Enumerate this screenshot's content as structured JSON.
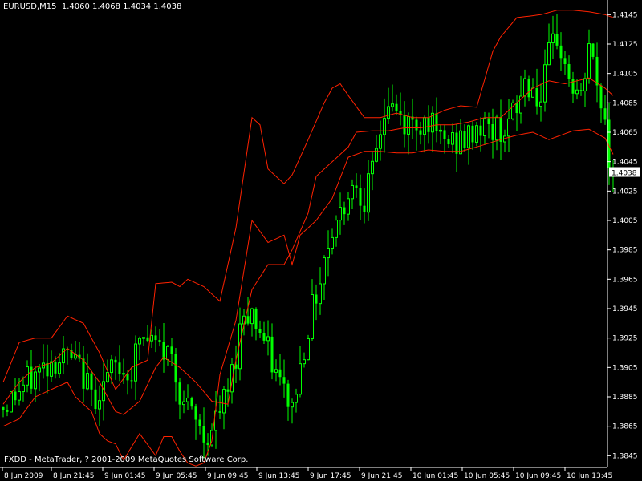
{
  "header": {
    "symbol": "EURUSD,M15",
    "ohlc": "1.4060 1.4068 1.4034 1.4038"
  },
  "footer": {
    "copyright": "FXDD - MetaTrader, ? 2001-2009 MetaQuotes Software Corp."
  },
  "colors": {
    "background": "#000000",
    "candle": "#00ff00",
    "bands": "#ff2200",
    "axis": "#ffffff",
    "price_line": "#c0c0c0"
  },
  "chart_data": {
    "type": "candlestick",
    "ylim": [
      1.3837,
      1.4155
    ],
    "y_ticks": [
      "1.4145",
      "1.4125",
      "1.4105",
      "1.4085",
      "1.4065",
      "1.4045",
      "1.4025",
      "1.4005",
      "1.3985",
      "1.3965",
      "1.3945",
      "1.3925",
      "1.3905",
      "1.3885",
      "1.3865",
      "1.3845"
    ],
    "x_ticks": [
      "8 Jun 2009",
      "8 Jun 21:45",
      "9 Jun 01:45",
      "9 Jun 05:45",
      "9 Jun 09:45",
      "9 Jun 13:45",
      "9 Jun 17:45",
      "9 Jun 21:45",
      "10 Jun 01:45",
      "10 Jun 05:45",
      "10 Jun 09:45",
      "10 Jun 13:45"
    ],
    "current_price": "1.4038",
    "close_path": [
      [
        0,
        1.3878
      ],
      [
        6,
        1.3895
      ],
      [
        12,
        1.391
      ],
      [
        16,
        1.3912
      ],
      [
        20,
        1.39
      ],
      [
        22,
        1.3885
      ],
      [
        24,
        1.389
      ],
      [
        28,
        1.3905
      ],
      [
        32,
        1.3902
      ],
      [
        34,
        1.3925
      ],
      [
        38,
        1.392
      ],
      [
        42,
        1.3912
      ],
      [
        44,
        1.389
      ],
      [
        46,
        1.3875
      ],
      [
        48,
        1.3868
      ],
      [
        50,
        1.3858
      ],
      [
        52,
        1.3862
      ],
      [
        56,
        1.3888
      ],
      [
        58,
        1.3915
      ],
      [
        60,
        1.3945
      ],
      [
        62,
        1.3942
      ],
      [
        64,
        1.393
      ],
      [
        66,
        1.3915
      ],
      [
        68,
        1.39
      ],
      [
        70,
        1.3888
      ],
      [
        72,
        1.3878
      ],
      [
        74,
        1.3905
      ],
      [
        76,
        1.3935
      ],
      [
        78,
        1.3955
      ],
      [
        80,
        1.398
      ],
      [
        82,
        1.4
      ],
      [
        84,
        1.401
      ],
      [
        86,
        1.4025
      ],
      [
        88,
        1.4032
      ],
      [
        90,
        1.402
      ],
      [
        92,
        1.4035
      ],
      [
        94,
        1.4068
      ],
      [
        96,
        1.4085
      ],
      [
        100,
        1.407
      ],
      [
        104,
        1.4072
      ],
      [
        106,
        1.4075
      ],
      [
        108,
        1.406
      ],
      [
        112,
        1.4058
      ],
      [
        116,
        1.406
      ],
      [
        118,
        1.407
      ],
      [
        122,
        1.4066
      ],
      [
        126,
        1.407
      ],
      [
        128,
        1.408
      ],
      [
        130,
        1.41
      ],
      [
        132,
        1.4095
      ],
      [
        134,
        1.4085
      ],
      [
        136,
        1.4115
      ],
      [
        138,
        1.413
      ],
      [
        140,
        1.411
      ],
      [
        142,
        1.4095
      ],
      [
        144,
        1.4085
      ],
      [
        146,
        1.4125
      ],
      [
        148,
        1.4095
      ],
      [
        150,
        1.4075
      ],
      [
        151,
        1.4045
      ],
      [
        152,
        1.4038
      ]
    ],
    "band_upper": [
      [
        0,
        1.3895
      ],
      [
        4,
        1.3922
      ],
      [
        8,
        1.3925
      ],
      [
        12,
        1.3925
      ],
      [
        16,
        1.394
      ],
      [
        20,
        1.3935
      ],
      [
        24,
        1.3915
      ],
      [
        28,
        1.389
      ],
      [
        32,
        1.3905
      ],
      [
        36,
        1.391
      ],
      [
        38,
        1.3962
      ],
      [
        42,
        1.3963
      ],
      [
        44,
        1.396
      ],
      [
        46,
        1.3965
      ],
      [
        50,
        1.396
      ],
      [
        54,
        1.395
      ],
      [
        58,
        1.4
      ],
      [
        62,
        1.4075
      ],
      [
        64,
        1.407
      ],
      [
        66,
        1.404
      ],
      [
        70,
        1.403
      ],
      [
        72,
        1.4036
      ],
      [
        76,
        1.406
      ],
      [
        80,
        1.4085
      ],
      [
        82,
        1.4095
      ],
      [
        84,
        1.4098
      ],
      [
        86,
        1.409
      ],
      [
        90,
        1.4075
      ],
      [
        94,
        1.4075
      ],
      [
        98,
        1.4078
      ],
      [
        102,
        1.4075
      ],
      [
        106,
        1.4075
      ],
      [
        110,
        1.408
      ],
      [
        114,
        1.4083
      ],
      [
        118,
        1.4082
      ],
      [
        122,
        1.412
      ],
      [
        124,
        1.413
      ],
      [
        128,
        1.4143
      ],
      [
        134,
        1.4145
      ],
      [
        138,
        1.4148
      ],
      [
        142,
        1.4148
      ],
      [
        146,
        1.4147
      ],
      [
        150,
        1.4145
      ],
      [
        152,
        1.4143
      ]
    ],
    "band_middle": [
      [
        0,
        1.388
      ],
      [
        4,
        1.3895
      ],
      [
        8,
        1.3905
      ],
      [
        12,
        1.3908
      ],
      [
        16,
        1.3918
      ],
      [
        20,
        1.391
      ],
      [
        24,
        1.3895
      ],
      [
        28,
        1.3875
      ],
      [
        30,
        1.3873
      ],
      [
        34,
        1.3882
      ],
      [
        38,
        1.3905
      ],
      [
        40,
        1.3912
      ],
      [
        44,
        1.3905
      ],
      [
        48,
        1.3895
      ],
      [
        52,
        1.3882
      ],
      [
        56,
        1.388
      ],
      [
        58,
        1.391
      ],
      [
        62,
        1.3958
      ],
      [
        66,
        1.3975
      ],
      [
        70,
        1.3975
      ],
      [
        72,
        1.3985
      ],
      [
        76,
        1.401
      ],
      [
        78,
        1.4035
      ],
      [
        82,
        1.4045
      ],
      [
        86,
        1.4055
      ],
      [
        88,
        1.4065
      ],
      [
        92,
        1.4066
      ],
      [
        96,
        1.4066
      ],
      [
        100,
        1.4068
      ],
      [
        104,
        1.4068
      ],
      [
        108,
        1.407
      ],
      [
        112,
        1.407
      ],
      [
        116,
        1.4072
      ],
      [
        120,
        1.4075
      ],
      [
        124,
        1.4075
      ],
      [
        128,
        1.4085
      ],
      [
        132,
        1.4095
      ],
      [
        136,
        1.41
      ],
      [
        140,
        1.4098
      ],
      [
        146,
        1.4102
      ],
      [
        150,
        1.4095
      ],
      [
        152,
        1.409
      ]
    ],
    "band_lower": [
      [
        0,
        1.3865
      ],
      [
        4,
        1.387
      ],
      [
        8,
        1.3885
      ],
      [
        12,
        1.389
      ],
      [
        16,
        1.3895
      ],
      [
        18,
        1.3885
      ],
      [
        20,
        1.388
      ],
      [
        22,
        1.3875
      ],
      [
        24,
        1.386
      ],
      [
        26,
        1.3855
      ],
      [
        28,
        1.3853
      ],
      [
        30,
        1.3842
      ],
      [
        34,
        1.386
      ],
      [
        38,
        1.3845
      ],
      [
        40,
        1.3858
      ],
      [
        42,
        1.3858
      ],
      [
        44,
        1.3848
      ],
      [
        46,
        1.384
      ],
      [
        48,
        1.3838
      ],
      [
        50,
        1.384
      ],
      [
        52,
        1.3855
      ],
      [
        54,
        1.39
      ],
      [
        58,
        1.3937
      ],
      [
        62,
        1.4005
      ],
      [
        66,
        1.399
      ],
      [
        70,
        1.3995
      ],
      [
        72,
        1.3975
      ],
      [
        74,
        1.3995
      ],
      [
        78,
        1.4005
      ],
      [
        82,
        1.402
      ],
      [
        86,
        1.4048
      ],
      [
        90,
        1.4052
      ],
      [
        94,
        1.4052
      ],
      [
        98,
        1.4051
      ],
      [
        102,
        1.4051
      ],
      [
        106,
        1.4053
      ],
      [
        110,
        1.4052
      ],
      [
        114,
        1.4052
      ],
      [
        118,
        1.4055
      ],
      [
        124,
        1.406
      ],
      [
        128,
        1.4063
      ],
      [
        132,
        1.4065
      ],
      [
        136,
        1.406
      ],
      [
        138,
        1.4062
      ],
      [
        142,
        1.4066
      ],
      [
        146,
        1.4067
      ],
      [
        150,
        1.4061
      ],
      [
        152,
        1.405
      ]
    ]
  }
}
